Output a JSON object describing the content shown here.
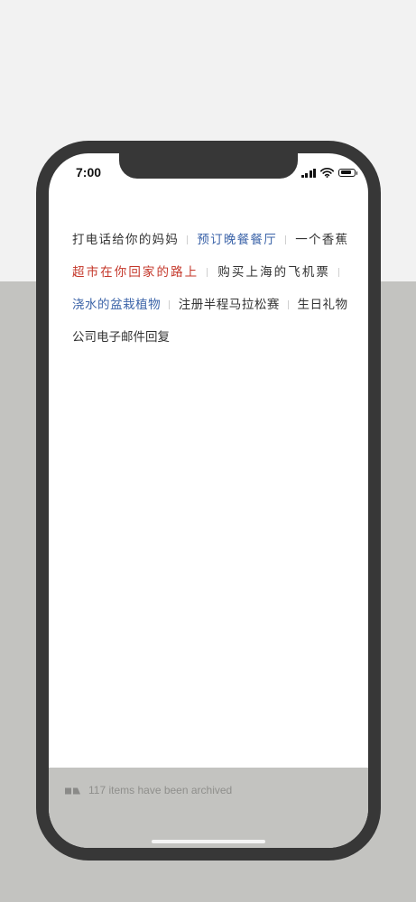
{
  "status_bar": {
    "time": "7:00",
    "icons": [
      "cellular-signal-icon",
      "wifi-icon",
      "battery-icon"
    ]
  },
  "list": {
    "items": [
      {
        "label": "打电话给你的妈妈",
        "color": "#333333"
      },
      {
        "label": "预订晚餐餐厅",
        "color": "#3b63a8"
      },
      {
        "label": "一个香蕉",
        "color": "#333333"
      },
      {
        "label": "超市在你回家的路上",
        "color": "#c4372a"
      },
      {
        "label": "购买上海的飞机票",
        "color": "#333333"
      },
      {
        "label": "浇水的盆栽植物",
        "color": "#3b63a8"
      },
      {
        "label": "注册半程马拉松赛",
        "color": "#333333"
      },
      {
        "label": "生日礼物",
        "color": "#333333"
      },
      {
        "label": "公司电子邮件回复",
        "color": "#333333"
      }
    ]
  },
  "footer": {
    "archive_icon": "archive-icon",
    "archive_text": "117 items have been archived"
  },
  "colors": {
    "background_top": "#f2f2f2",
    "background_bottom": "#c3c3c0",
    "phone_frame": "#373737",
    "accent_blue": "#3b63a8",
    "accent_red": "#c4372a"
  }
}
